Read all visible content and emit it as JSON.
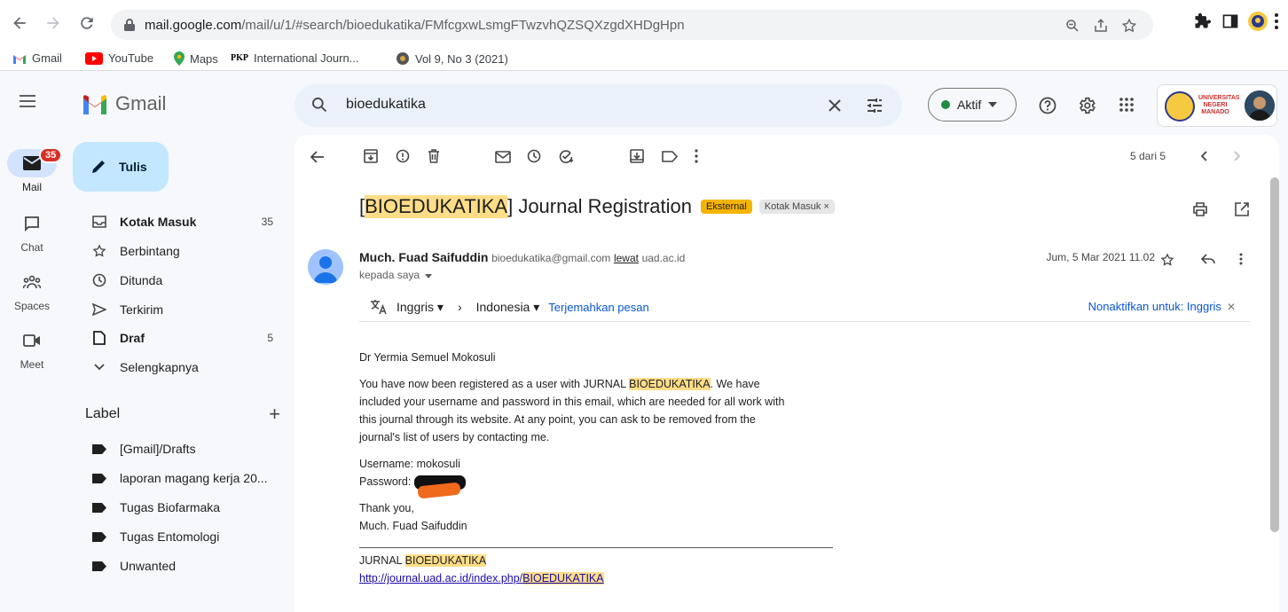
{
  "browser": {
    "url_domain": "mail.google.com",
    "url_path": "/mail/u/1/#search/bioedukatika/FMfcgxwLsmgFTwzvhQZSQXzgdXHDgHpn",
    "bookmarks": [
      "Gmail",
      "YouTube",
      "Maps",
      "International Journ...",
      "Vol 9, No 3 (2021)"
    ],
    "bookmark_pkp_prefix": "PKP"
  },
  "header": {
    "app_name": "Gmail",
    "search_query": "bioedukatika",
    "status_label": "Aktif",
    "account_org": "UNIVERSITAS NEGERI MANADO"
  },
  "rail": {
    "mail_label": "Mail",
    "mail_badge": "35",
    "chat_label": "Chat",
    "spaces_label": "Spaces",
    "meet_label": "Meet"
  },
  "nav": {
    "compose_label": "Tulis",
    "items": [
      {
        "label": "Kotak Masuk",
        "count": "35"
      },
      {
        "label": "Berbintang",
        "count": ""
      },
      {
        "label": "Ditunda",
        "count": ""
      },
      {
        "label": "Terkirim",
        "count": ""
      },
      {
        "label": "Draf",
        "count": "5"
      },
      {
        "label": "Selengkapnya",
        "count": ""
      }
    ],
    "labels_heading": "Label",
    "labels": [
      "[Gmail]/Drafts",
      "laporan magang kerja 20...",
      "Tugas Biofarmaka",
      "Tugas Entomologi",
      "Unwanted"
    ]
  },
  "message": {
    "pager": "5 dari 5",
    "subject_open": "[",
    "subject_highlight": "BIOEDUKATIKA",
    "subject_rest": "] Journal Registration",
    "tag_external": "Eksternal",
    "tag_inbox": "Kotak Masuk",
    "sender_name": "Much. Fuad Saifuddin",
    "sender_email": "bioedukatika@gmail.com",
    "via_word": "lewat",
    "via_domain": "uad.ac.id",
    "to_line": "kepada saya",
    "date": "Jum, 5 Mar 2021 11.02",
    "translate_from": "Inggris",
    "translate_to": "Indonesia",
    "translate_link": "Terjemahkan pesan",
    "translate_disable": "Nonaktifkan untuk: Inggris",
    "greeting": "Dr Yermia Semuel Mokosuli",
    "para_before": "You have now been registered as a user with JURNAL ",
    "para_highlight": "BIOEDUKATIKA",
    "para_after": ". We have included your username and password in this email, which are needed for all work with this journal through its website. At any point, you can ask to be removed from the journal's list of users by contacting me.",
    "username_line": "Username: mokosuli",
    "password_label": "Password: ",
    "thanks": "Thank you,",
    "signer": "Much. Fuad Saifuddin",
    "footer_prefix": "JURNAL ",
    "footer_highlight": "BIOEDUKATIKA",
    "footer_url_prefix": "http://journal.uad.ac.id/index.php/",
    "footer_url_highlight": "BIOEDUKATIKA"
  }
}
